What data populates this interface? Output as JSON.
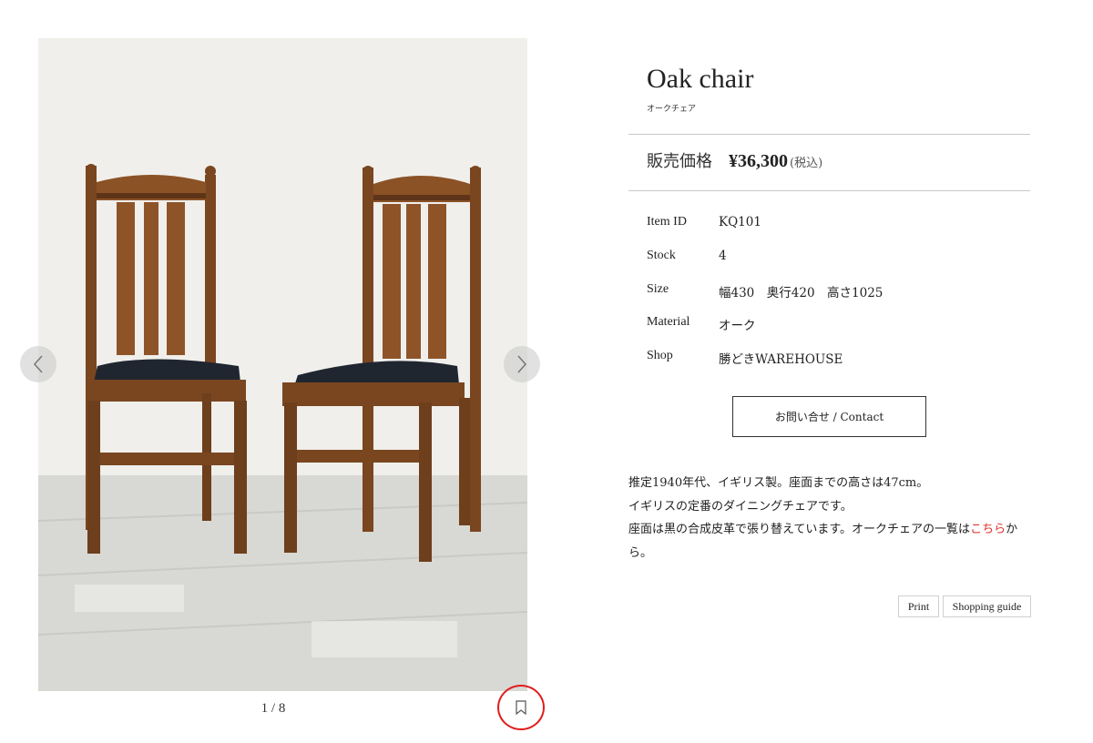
{
  "product": {
    "title": "Oak chair",
    "subtitle": "オークチェア",
    "price_label": "販売価格",
    "price": "¥36,300",
    "price_note": "(税込)"
  },
  "specs": [
    {
      "key": "Item ID",
      "value": "KQ101"
    },
    {
      "key": "Stock",
      "value": "4"
    },
    {
      "key": "Size",
      "value": "幅430　奥行420　高さ1025"
    },
    {
      "key": "Material",
      "value": "オーク"
    },
    {
      "key": "Shop",
      "value": "勝どきWAREHOUSE"
    }
  ],
  "contact_button": "お問い合せ / Contact",
  "description": {
    "line1": "推定1940年代、イギリス製。座面までの高さは47cm。",
    "line2": "イギリスの定番のダイニングチェアです。",
    "line3_before": "座面は黒の合成皮革で張り替えています。オークチェアの一覧は",
    "line3_link": "こちら",
    "line3_after": "から。"
  },
  "buttons": {
    "print": "Print",
    "guide": "Shopping guide"
  },
  "gallery": {
    "counter": "1 / 8",
    "prev_icon": "chevron-left-icon",
    "next_icon": "chevron-right-icon",
    "bookmark_icon": "bookmark-icon"
  },
  "colors": {
    "accent_link": "#e0322a",
    "highlight_circle": "#e01e1e"
  }
}
